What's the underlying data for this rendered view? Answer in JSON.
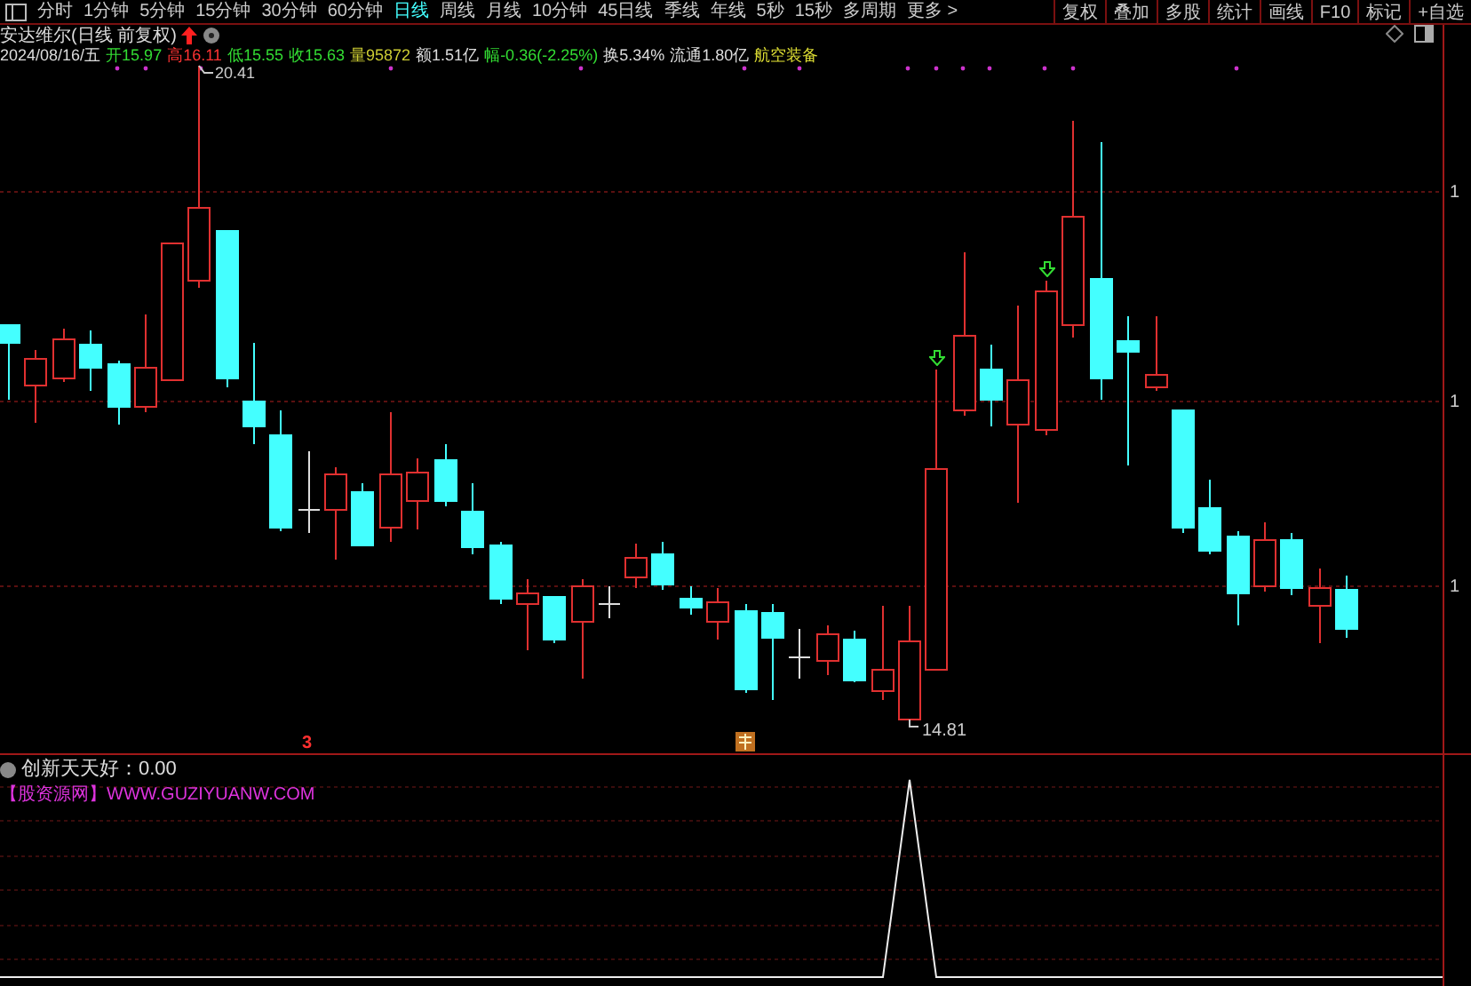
{
  "toolbar": {
    "periods": [
      {
        "label": "分时",
        "selected": false
      },
      {
        "label": "1分钟",
        "selected": false
      },
      {
        "label": "5分钟",
        "selected": false
      },
      {
        "label": "15分钟",
        "selected": false
      },
      {
        "label": "30分钟",
        "selected": false
      },
      {
        "label": "60分钟",
        "selected": false
      },
      {
        "label": "日线",
        "selected": true
      },
      {
        "label": "周线",
        "selected": false
      },
      {
        "label": "月线",
        "selected": false
      },
      {
        "label": "10分钟",
        "selected": false
      },
      {
        "label": "45日线",
        "selected": false
      },
      {
        "label": "季线",
        "selected": false
      },
      {
        "label": "年线",
        "selected": false
      },
      {
        "label": "5秒",
        "selected": false
      },
      {
        "label": "15秒",
        "selected": false
      },
      {
        "label": "多周期",
        "selected": false
      },
      {
        "label": "更多 >",
        "selected": false
      }
    ],
    "buttons": [
      "复权",
      "叠加",
      "多股",
      "统计",
      "画线",
      "F10",
      "标记",
      "+自选"
    ]
  },
  "chart": {
    "title": "安达维尔(日线 前复权)",
    "date": "2024/08/16/五",
    "quote": [
      {
        "label": "开",
        "value": "15.97",
        "color": "#33dd33"
      },
      {
        "label": "高",
        "value": "16.11",
        "color": "#ff3333"
      },
      {
        "label": "低",
        "value": "15.55",
        "color": "#33dd33"
      },
      {
        "label": "收",
        "value": "15.63",
        "color": "#33dd33"
      },
      {
        "label": "量",
        "value": "95872",
        "color": "#cccc33"
      },
      {
        "label": "额",
        "value": "1.51亿",
        "color": "#dddddd"
      },
      {
        "label": "幅",
        "value": "-0.36(-2.25%)",
        "color": "#33dd33"
      },
      {
        "label": "换",
        "value": "5.34%",
        "color": "#dddddd"
      },
      {
        "label": "流通",
        "value": "1.80亿",
        "color": "#dddddd"
      }
    ],
    "sector": "航空装备",
    "high_label": "20.41",
    "low_label": "14.81",
    "marker": "3",
    "axis_labels": [
      "1",
      "1",
      "1"
    ]
  },
  "indicator": {
    "name": "创新天天好",
    "separator": "：",
    "value": "0.00",
    "source": "【股资源网】WWW.GUZIYUANW.COM"
  }
}
